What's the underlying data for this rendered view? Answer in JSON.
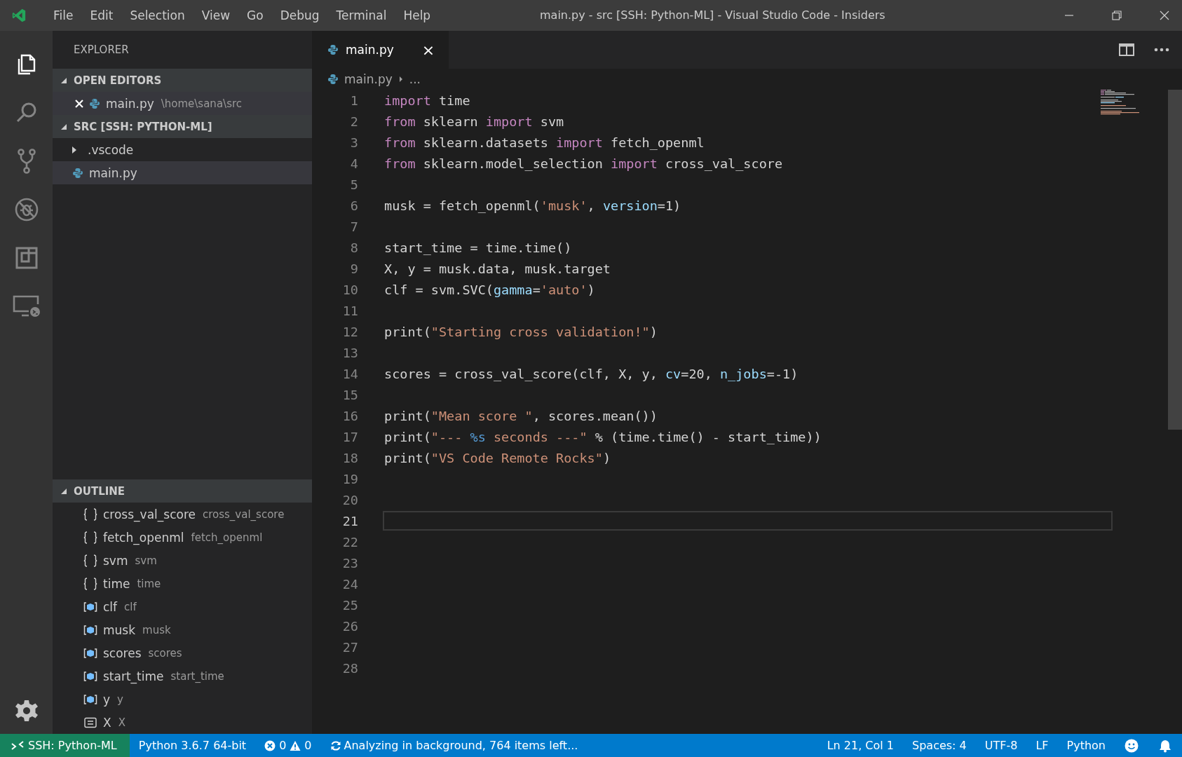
{
  "window": {
    "title": "main.py - src [SSH: Python-ML] - Visual Studio Code - Insiders"
  },
  "menu": [
    "File",
    "Edit",
    "Selection",
    "View",
    "Go",
    "Debug",
    "Terminal",
    "Help"
  ],
  "activity_bar": [
    {
      "kind": "files",
      "selected": true
    },
    {
      "kind": "search",
      "selected": false
    },
    {
      "kind": "scm",
      "selected": false
    },
    {
      "kind": "debug",
      "selected": false
    },
    {
      "kind": "extensions",
      "selected": false
    },
    {
      "kind": "remote",
      "selected": false
    }
  ],
  "sidebar": {
    "title": "EXPLORER",
    "open_editors": {
      "title": "OPEN EDITORS",
      "expanded": true,
      "items": [
        {
          "name": "main.py",
          "path": "\\home\\sana\\src"
        }
      ]
    },
    "folder": {
      "title": "SRC [SSH: PYTHON-ML]",
      "expanded": true,
      "items": [
        {
          "name": ".vscode",
          "kind": "folder",
          "expanded": false,
          "selected": false
        },
        {
          "name": "main.py",
          "kind": "python",
          "selected": true
        }
      ]
    },
    "outline": {
      "title": "OUTLINE",
      "expanded": true,
      "items": [
        {
          "name": "cross_val_score",
          "detail": "cross_val_score",
          "kind": "module"
        },
        {
          "name": "fetch_openml",
          "detail": "fetch_openml",
          "kind": "module"
        },
        {
          "name": "svm",
          "detail": "svm",
          "kind": "module"
        },
        {
          "name": "time",
          "detail": "time",
          "kind": "module"
        },
        {
          "name": "clf",
          "detail": "clf",
          "kind": "variable"
        },
        {
          "name": "musk",
          "detail": "musk",
          "kind": "variable"
        },
        {
          "name": "scores",
          "detail": "scores",
          "kind": "variable"
        },
        {
          "name": "start_time",
          "detail": "start_time",
          "kind": "variable"
        },
        {
          "name": "y",
          "detail": "y",
          "kind": "variable"
        },
        {
          "name": "X",
          "detail": "X",
          "kind": "constant"
        }
      ]
    }
  },
  "tabs": [
    {
      "label": "main.py",
      "close": "×",
      "selected": true
    }
  ],
  "breadcrumb": [
    "main.py",
    "..."
  ],
  "code": [
    {
      "no": "1",
      "current": false,
      "tokens": [
        {
          "kind": "kw",
          "text": "import"
        },
        {
          "kind": "plain",
          "text": " time"
        }
      ]
    },
    {
      "no": "2",
      "current": false,
      "tokens": [
        {
          "kind": "kw",
          "text": "from"
        },
        {
          "kind": "plain",
          "text": " sklearn "
        },
        {
          "kind": "kw",
          "text": "import"
        },
        {
          "kind": "plain",
          "text": " svm"
        }
      ]
    },
    {
      "no": "3",
      "current": false,
      "tokens": [
        {
          "kind": "kw",
          "text": "from"
        },
        {
          "kind": "plain",
          "text": " sklearn.datasets "
        },
        {
          "kind": "kw",
          "text": "import"
        },
        {
          "kind": "plain",
          "text": " fetch_openml"
        }
      ]
    },
    {
      "no": "4",
      "current": false,
      "tokens": [
        {
          "kind": "kw",
          "text": "from"
        },
        {
          "kind": "plain",
          "text": " sklearn.model_selection "
        },
        {
          "kind": "kw",
          "text": "import"
        },
        {
          "kind": "plain",
          "text": " cross_val_score"
        }
      ]
    },
    {
      "no": "5",
      "current": false
    },
    {
      "no": "6",
      "current": false,
      "tokens": [
        {
          "kind": "plain",
          "text": "musk = fetch_openml("
        },
        {
          "kind": "str",
          "text": "'musk'"
        },
        {
          "kind": "plain",
          "text": ", "
        },
        {
          "kind": "param",
          "text": "version"
        },
        {
          "kind": "plain",
          "text": "=1)"
        }
      ]
    },
    {
      "no": "7",
      "current": false
    },
    {
      "no": "8",
      "current": false,
      "tokens": [
        {
          "kind": "plain",
          "text": "start_time = time.time()"
        }
      ]
    },
    {
      "no": "9",
      "current": false,
      "tokens": [
        {
          "kind": "plain",
          "text": "X, y = musk.data, musk.target"
        }
      ]
    },
    {
      "no": "10",
      "current": false,
      "tokens": [
        {
          "kind": "plain",
          "text": "clf = svm.SVC("
        },
        {
          "kind": "param",
          "text": "gamma"
        },
        {
          "kind": "plain",
          "text": "="
        },
        {
          "kind": "str",
          "text": "'auto'"
        },
        {
          "kind": "plain",
          "text": ")"
        }
      ]
    },
    {
      "no": "11",
      "current": false
    },
    {
      "no": "12",
      "current": false,
      "tokens": [
        {
          "kind": "plain",
          "text": "print("
        },
        {
          "kind": "str",
          "text": "\"Starting cross validation!\""
        },
        {
          "kind": "plain",
          "text": ")"
        }
      ]
    },
    {
      "no": "13",
      "current": false
    },
    {
      "no": "14",
      "current": false,
      "tokens": [
        {
          "kind": "plain",
          "text": "scores = cross_val_score(clf, X, y, "
        },
        {
          "kind": "param",
          "text": "cv"
        },
        {
          "kind": "plain",
          "text": "=20, "
        },
        {
          "kind": "param",
          "text": "n_jobs"
        },
        {
          "kind": "plain",
          "text": "=-1)"
        }
      ]
    },
    {
      "no": "15",
      "current": false
    },
    {
      "no": "16",
      "current": false,
      "tokens": [
        {
          "kind": "plain",
          "text": "print("
        },
        {
          "kind": "str",
          "text": "\"Mean score \""
        },
        {
          "kind": "plain",
          "text": ", scores.mean())"
        }
      ]
    },
    {
      "no": "17",
      "current": false,
      "tokens": [
        {
          "kind": "plain",
          "text": "print("
        },
        {
          "kind": "str",
          "text": "\"--- "
        },
        {
          "kind": "fmt",
          "text": "%s"
        },
        {
          "kind": "str",
          "text": " seconds ---\""
        },
        {
          "kind": "plain",
          "text": " % (time.time() - start_time))"
        }
      ]
    },
    {
      "no": "18",
      "current": false,
      "tokens": [
        {
          "kind": "plain",
          "text": "print("
        },
        {
          "kind": "str",
          "text": "\"VS Code Remote Rocks\""
        },
        {
          "kind": "plain",
          "text": ")"
        }
      ]
    },
    {
      "no": "19",
      "current": false
    },
    {
      "no": "20",
      "current": false
    },
    {
      "no": "21",
      "current": true
    },
    {
      "no": "22",
      "current": false
    },
    {
      "no": "23",
      "current": false
    },
    {
      "no": "24",
      "current": false
    },
    {
      "no": "25",
      "current": false
    },
    {
      "no": "26",
      "current": false
    },
    {
      "no": "27",
      "current": false
    },
    {
      "no": "28",
      "current": false
    }
  ],
  "status_bar": {
    "remote": "SSH: Python-ML",
    "interpreter": "Python 3.6.7 64-bit",
    "errors": "0",
    "warnings": "0",
    "activity": "Analyzing in background, 764 items left...",
    "right": [
      "Ln 21, Col 1",
      "Spaces: 4",
      "UTF-8",
      "LF",
      "Python"
    ]
  }
}
